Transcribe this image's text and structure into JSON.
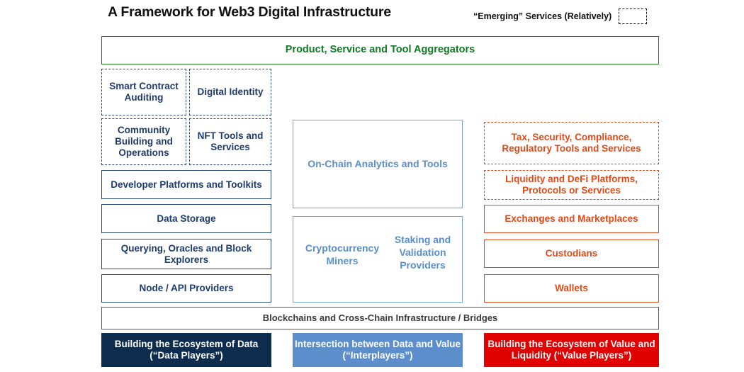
{
  "header": {
    "title": "A Framework for Web3 Digital Infrastructure",
    "legend_label": "“Emerging” Services (Relatively)",
    "legend_swatch_name": "dashed-box-swatch"
  },
  "aggregator": {
    "label": "Product, Service and Tool Aggregators",
    "color": "#0f7a22"
  },
  "columns": {
    "data": {
      "accent": "#1f3c6e",
      "emerging": [
        {
          "label": "Smart Contract Auditing"
        },
        {
          "label": "Digital Identity"
        },
        {
          "label": "Community Building and Operations"
        },
        {
          "label": "NFT Tools and Services"
        }
      ],
      "established": [
        {
          "label": "Developer Platforms and Toolkits"
        },
        {
          "label": "Data Storage"
        },
        {
          "label": "Querying, Oracles and Block Explorers"
        },
        {
          "label": "Node / API Providers"
        }
      ]
    },
    "interplayers": {
      "accent": "#5b8fc9",
      "boxes": [
        {
          "label": "On-Chain Analytics and Tools"
        }
      ],
      "split_box": {
        "left_label": "Cryptocurrency Miners",
        "right_label": "Staking and Validation Providers"
      }
    },
    "value": {
      "accent": "#e04a18",
      "emerging": [
        {
          "label": "Tax, Security, Compliance, Regulatory Tools and Services"
        },
        {
          "label": "Liquidity and DeFi Platforms, Protocols or Services"
        }
      ],
      "established": [
        {
          "label": "Exchanges and Marketplaces"
        },
        {
          "label": "Custodians"
        },
        {
          "label": "Wallets"
        }
      ]
    }
  },
  "base_layer": {
    "label": "Blockchains and Cross-Chain Infrastructure / Bridges",
    "color": "#3b3b3b"
  },
  "footers": [
    {
      "label": "Building the Ecosystem of Data (“Data Players”)",
      "color": "#0e2d4e"
    },
    {
      "label": "Intersection between Data and Value (“Interplayers”)",
      "color": "#5b8ecb"
    },
    {
      "label": "Building the Ecosystem of Value and Liquidity (“Value Players”)",
      "color": "#e00000"
    }
  ]
}
